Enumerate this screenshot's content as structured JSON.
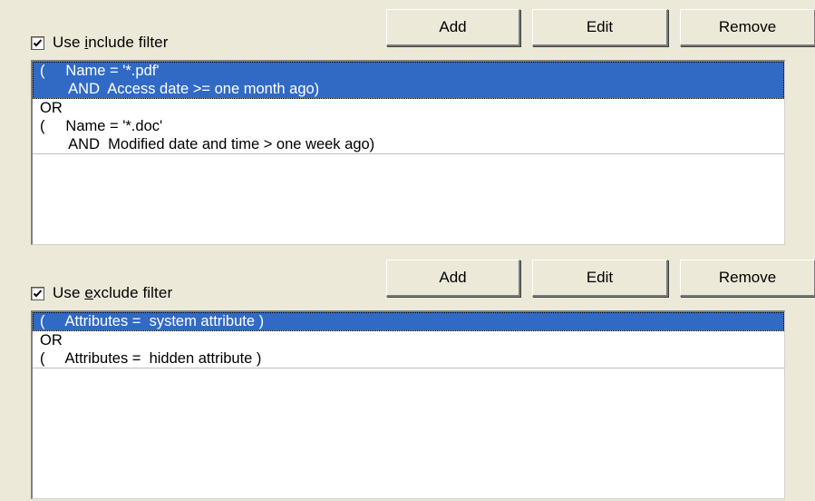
{
  "include": {
    "checkbox_checked": true,
    "label_pre": "Use ",
    "label_accel": "i",
    "label_post": "nclude filter",
    "buttons": {
      "add": "Add",
      "edit": "Edit",
      "remove": "Remove"
    },
    "items": [
      {
        "lines": [
          "(     Name = '*.pdf'",
          "       AND  Access date >= one month ago)"
        ],
        "selected": true
      },
      {
        "lines": [
          "OR",
          "(     Name = '*.doc'",
          "       AND  Modified date and time > one week ago)"
        ],
        "selected": false
      }
    ]
  },
  "exclude": {
    "checkbox_checked": true,
    "label_pre": "Use ",
    "label_accel": "e",
    "label_post": "xclude filter",
    "buttons": {
      "add": "Add",
      "edit": "Edit",
      "remove": "Remove"
    },
    "items": [
      {
        "lines": [
          "(     Attributes =  system attribute )"
        ],
        "selected": true
      },
      {
        "lines": [
          "OR",
          "(     Attributes =  hidden attribute )"
        ],
        "selected": false
      }
    ]
  }
}
